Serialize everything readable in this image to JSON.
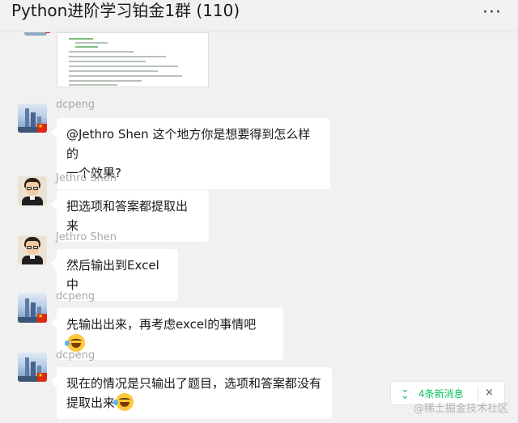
{
  "header": {
    "title": "Python进阶学习铂金1群 (110)",
    "more_icon": "more-dots-icon"
  },
  "messages": [
    {
      "sender": "dcpeng",
      "avatar": "city-skyline-avatar",
      "lines": [
        "@Jethro Shen 这个地方你是想要得到怎么样的",
        "一个效果?"
      ]
    },
    {
      "sender": "Jethro Shen",
      "avatar": "cartoon-man-avatar",
      "lines": [
        "把选项和答案都提取出来"
      ]
    },
    {
      "sender": "Jethro Shen",
      "avatar": "cartoon-man-avatar",
      "lines": [
        "然后输出到Excel中"
      ]
    },
    {
      "sender": "dcpeng",
      "avatar": "city-skyline-avatar",
      "lines": [
        "先输出出来，再考虑excel的事情吧"
      ],
      "emoji": "laugh-cry-emoji"
    },
    {
      "sender": "dcpeng",
      "avatar": "city-skyline-avatar",
      "lines": [
        "现在的情况是只输出了题目，选项和答案都没有",
        "提取出来"
      ],
      "emoji": "laugh-cry-emoji"
    }
  ],
  "new_messages": {
    "label": "4条新消息",
    "icon": "double-chevron-down-icon",
    "close": "×"
  },
  "watermark": "@稀土掘金技术社区",
  "colors": {
    "accent": "#07c160",
    "background": "#f1f1f1",
    "bubble": "#ffffff"
  }
}
